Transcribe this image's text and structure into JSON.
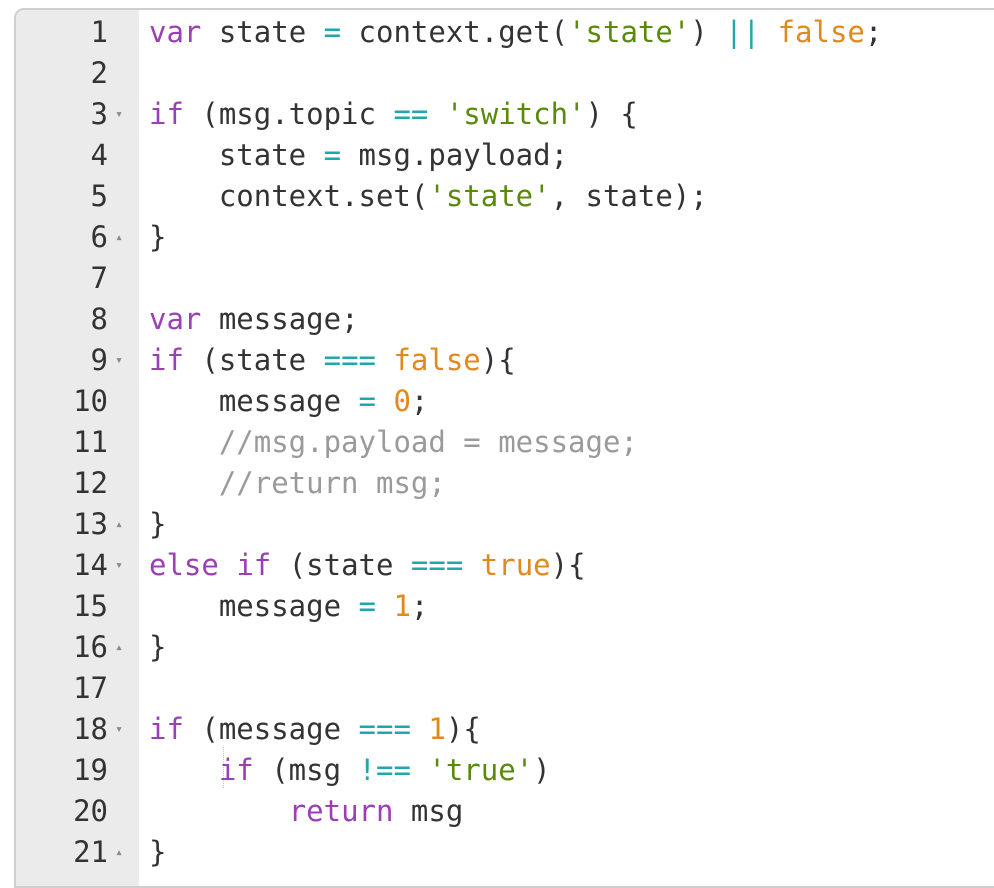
{
  "editor": {
    "lines": [
      {
        "num": "1",
        "fold": "",
        "tokens": [
          {
            "t": "kw",
            "v": "var"
          },
          {
            "t": "tx",
            "v": " state "
          },
          {
            "t": "op",
            "v": "="
          },
          {
            "t": "tx",
            "v": " context.get("
          },
          {
            "t": "str",
            "v": "'state'"
          },
          {
            "t": "tx",
            "v": ") "
          },
          {
            "t": "op",
            "v": "||"
          },
          {
            "t": "tx",
            "v": " "
          },
          {
            "t": "num",
            "v": "false"
          },
          {
            "t": "tx",
            "v": ";"
          }
        ]
      },
      {
        "num": "2",
        "fold": "",
        "tokens": []
      },
      {
        "num": "3",
        "fold": "▾",
        "tokens": [
          {
            "t": "kw",
            "v": "if"
          },
          {
            "t": "tx",
            "v": " (msg.topic "
          },
          {
            "t": "op",
            "v": "=="
          },
          {
            "t": "tx",
            "v": " "
          },
          {
            "t": "str",
            "v": "'switch'"
          },
          {
            "t": "tx",
            "v": ") {"
          }
        ]
      },
      {
        "num": "4",
        "fold": "",
        "tokens": [
          {
            "t": "tx",
            "v": "    state "
          },
          {
            "t": "op",
            "v": "="
          },
          {
            "t": "tx",
            "v": " msg.payload;"
          }
        ]
      },
      {
        "num": "5",
        "fold": "",
        "tokens": [
          {
            "t": "tx",
            "v": "    context.set("
          },
          {
            "t": "str",
            "v": "'state'"
          },
          {
            "t": "tx",
            "v": ", state);"
          }
        ]
      },
      {
        "num": "6",
        "fold": "▴",
        "tokens": [
          {
            "t": "tx",
            "v": "}"
          }
        ]
      },
      {
        "num": "7",
        "fold": "",
        "tokens": []
      },
      {
        "num": "8",
        "fold": "",
        "tokens": [
          {
            "t": "kw",
            "v": "var"
          },
          {
            "t": "tx",
            "v": " message;"
          }
        ]
      },
      {
        "num": "9",
        "fold": "▾",
        "tokens": [
          {
            "t": "kw",
            "v": "if"
          },
          {
            "t": "tx",
            "v": " (state "
          },
          {
            "t": "op",
            "v": "==="
          },
          {
            "t": "tx",
            "v": " "
          },
          {
            "t": "num",
            "v": "false"
          },
          {
            "t": "tx",
            "v": "){"
          }
        ]
      },
      {
        "num": "10",
        "fold": "",
        "tokens": [
          {
            "t": "tx",
            "v": "    message "
          },
          {
            "t": "op",
            "v": "="
          },
          {
            "t": "tx",
            "v": " "
          },
          {
            "t": "num",
            "v": "0"
          },
          {
            "t": "tx",
            "v": ";"
          }
        ]
      },
      {
        "num": "11",
        "fold": "",
        "tokens": [
          {
            "t": "tx",
            "v": "    "
          },
          {
            "t": "cm",
            "v": "//msg.payload = message;"
          }
        ]
      },
      {
        "num": "12",
        "fold": "",
        "tokens": [
          {
            "t": "tx",
            "v": "    "
          },
          {
            "t": "cm",
            "v": "//return msg;"
          }
        ]
      },
      {
        "num": "13",
        "fold": "▴",
        "tokens": [
          {
            "t": "tx",
            "v": "}"
          }
        ]
      },
      {
        "num": "14",
        "fold": "▾",
        "tokens": [
          {
            "t": "kw",
            "v": "else"
          },
          {
            "t": "tx",
            "v": " "
          },
          {
            "t": "kw",
            "v": "if"
          },
          {
            "t": "tx",
            "v": " (state "
          },
          {
            "t": "op",
            "v": "==="
          },
          {
            "t": "tx",
            "v": " "
          },
          {
            "t": "num",
            "v": "true"
          },
          {
            "t": "tx",
            "v": "){"
          }
        ]
      },
      {
        "num": "15",
        "fold": "",
        "tokens": [
          {
            "t": "tx",
            "v": "    message "
          },
          {
            "t": "op",
            "v": "="
          },
          {
            "t": "tx",
            "v": " "
          },
          {
            "t": "num",
            "v": "1"
          },
          {
            "t": "tx",
            "v": ";"
          }
        ]
      },
      {
        "num": "16",
        "fold": "▴",
        "tokens": [
          {
            "t": "tx",
            "v": "}"
          }
        ]
      },
      {
        "num": "17",
        "fold": "",
        "tokens": []
      },
      {
        "num": "18",
        "fold": "▾",
        "tokens": [
          {
            "t": "kw",
            "v": "if"
          },
          {
            "t": "tx",
            "v": " (message "
          },
          {
            "t": "op",
            "v": "==="
          },
          {
            "t": "tx",
            "v": " "
          },
          {
            "t": "num",
            "v": "1"
          },
          {
            "t": "tx",
            "v": "){"
          }
        ]
      },
      {
        "num": "19",
        "fold": "",
        "tokens": [
          {
            "t": "tx",
            "v": "    "
          },
          {
            "t": "kw",
            "v": "if"
          },
          {
            "t": "tx",
            "v": " (msg "
          },
          {
            "t": "op",
            "v": "!=="
          },
          {
            "t": "tx",
            "v": " "
          },
          {
            "t": "str",
            "v": "'true'"
          },
          {
            "t": "tx",
            "v": ")"
          }
        ]
      },
      {
        "num": "20",
        "fold": "",
        "tokens": [
          {
            "t": "tx",
            "v": "        "
          },
          {
            "t": "kw",
            "v": "return"
          },
          {
            "t": "tx",
            "v": " msg"
          }
        ]
      },
      {
        "num": "21",
        "fold": "▴",
        "tokens": [
          {
            "t": "tx",
            "v": "}"
          }
        ]
      }
    ],
    "colors": {
      "keyword": "#9a3fb5",
      "operator": "#22a6ac",
      "string": "#5a8a0a",
      "number": "#e2891e",
      "comment": "#9a9a9a",
      "text": "#333333",
      "gutter_bg": "#ebebeb"
    }
  }
}
